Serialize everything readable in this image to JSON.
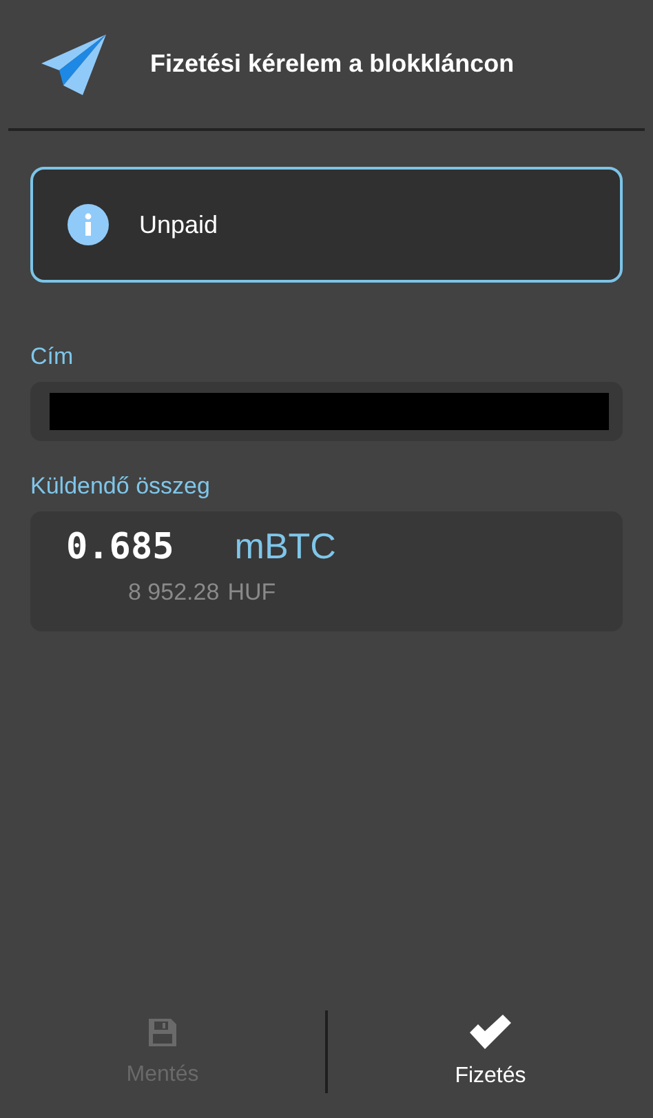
{
  "header": {
    "title": "Fizetési kérelem a blokkláncon"
  },
  "status": {
    "text": "Unpaid"
  },
  "address": {
    "label": "Cím",
    "redacted": true
  },
  "amount": {
    "label": "Küldendő összeg",
    "value": "0.685",
    "unit": "mBTC",
    "fiat_value": "8 952.28",
    "fiat_unit": "HUF"
  },
  "actions": [
    {
      "kind": "save",
      "label": "Mentés",
      "disabled": true
    },
    {
      "kind": "pay",
      "label": "Fizetés",
      "disabled": false
    }
  ]
}
